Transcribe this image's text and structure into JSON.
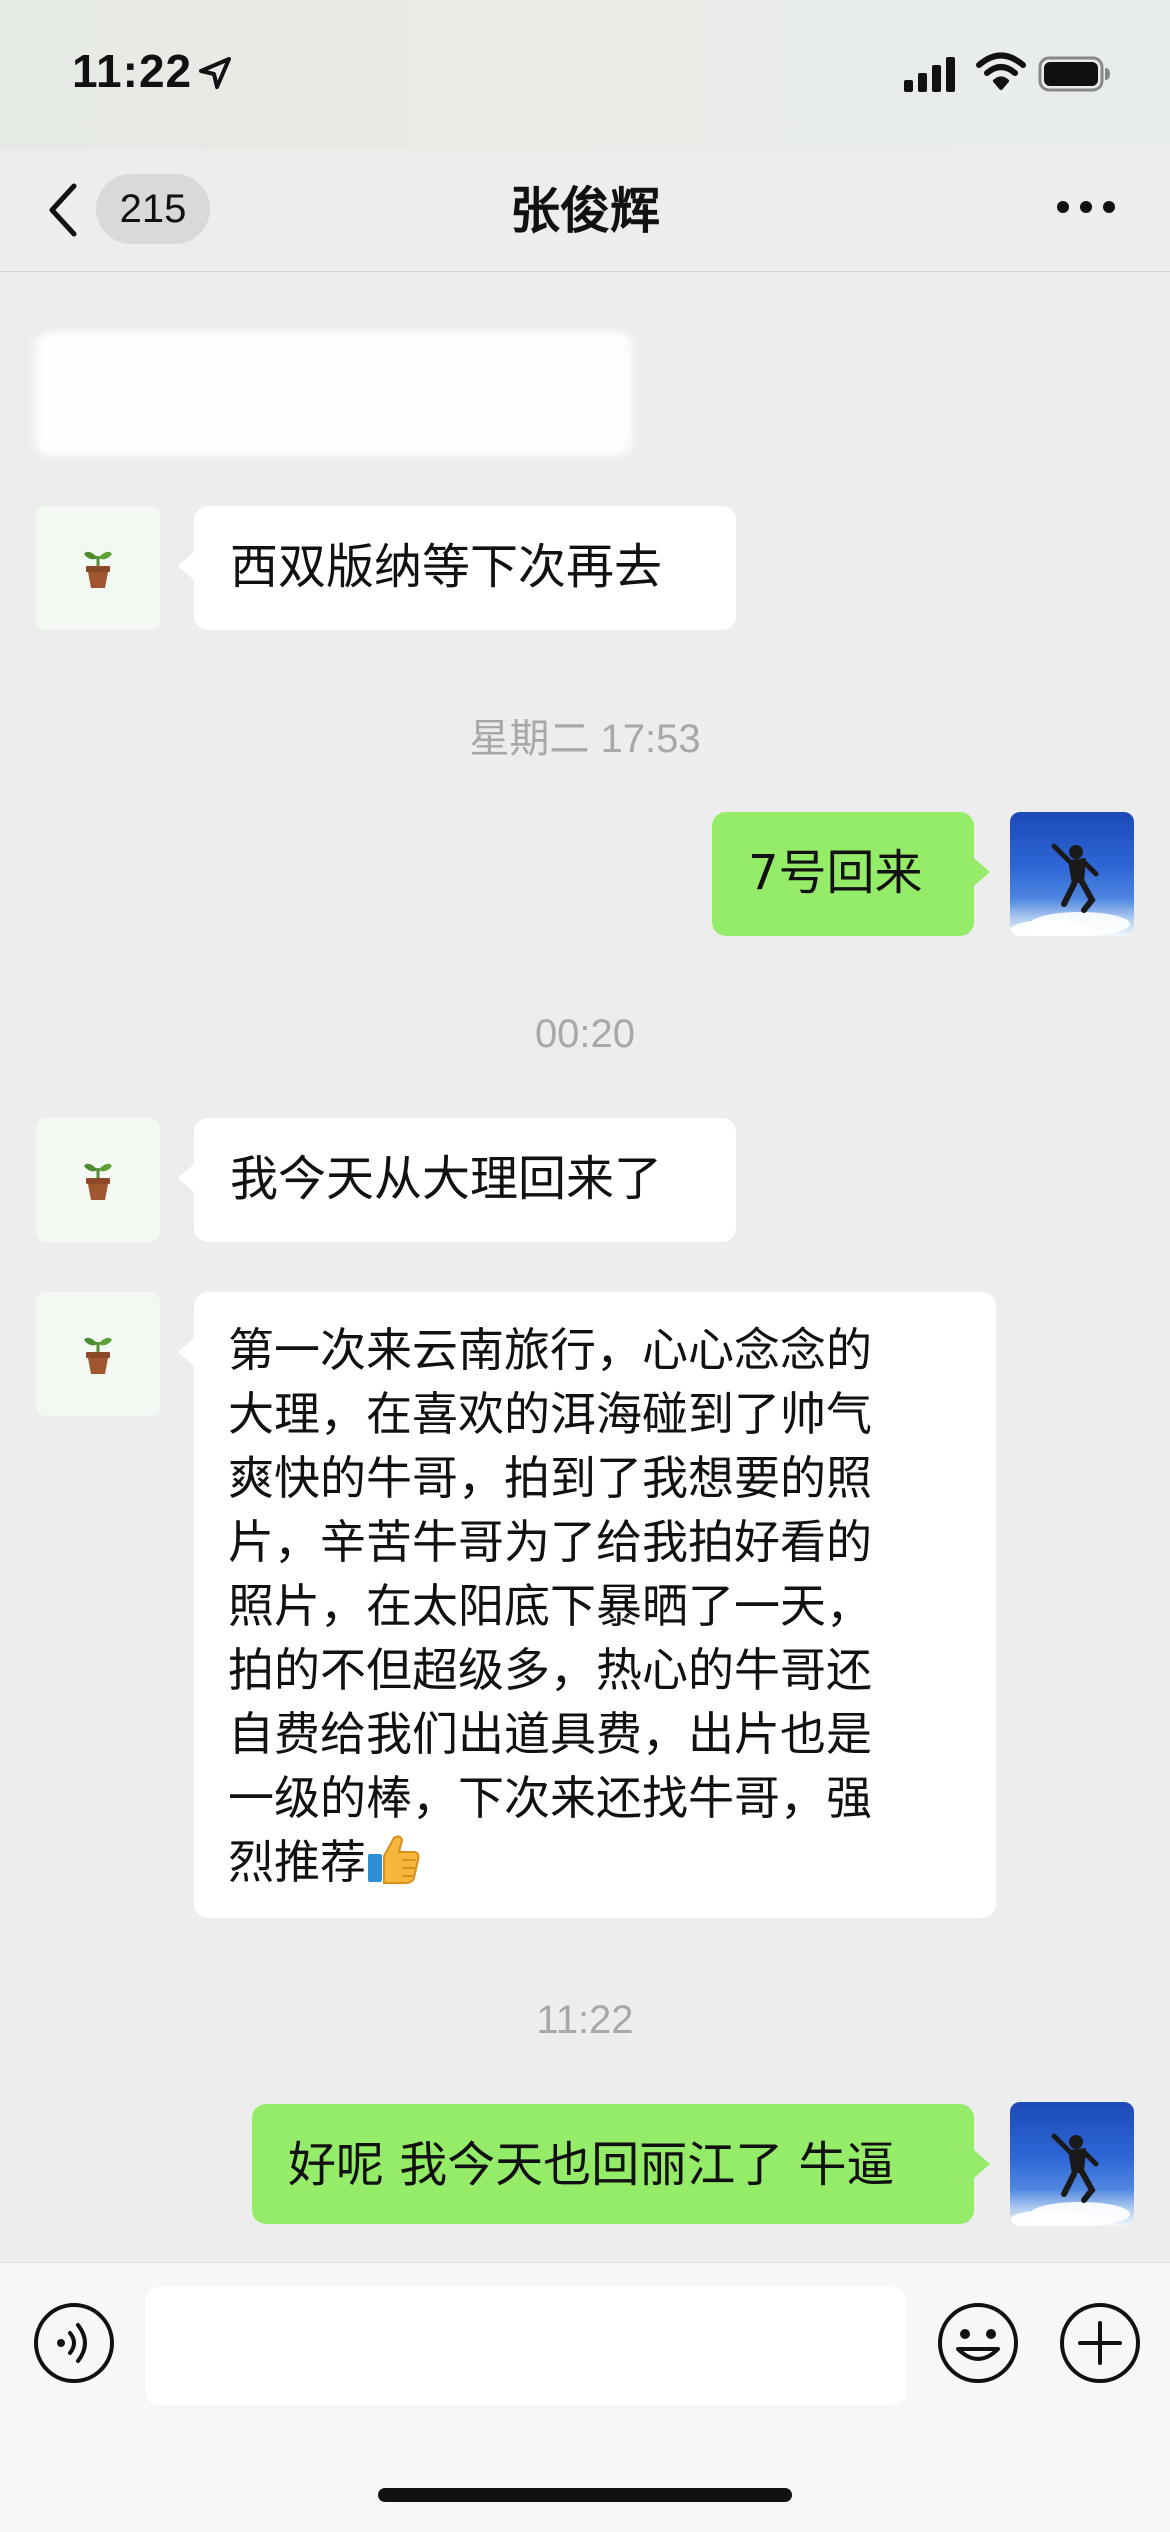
{
  "status_bar": {
    "time": "11:22"
  },
  "header": {
    "unread_count": "215",
    "title": "张俊辉"
  },
  "messages": [
    {
      "sender": "other",
      "text": "西双版纳等下次再去"
    },
    {
      "type": "timestamp",
      "text": "星期二 17:53"
    },
    {
      "sender": "me",
      "text": "7号回来"
    },
    {
      "type": "timestamp",
      "text": "00:20"
    },
    {
      "sender": "other",
      "text": "我今天从大理回来了"
    },
    {
      "sender": "other",
      "text": "第一次来云南旅行，心心念念的\n大理，在喜欢的洱海碰到了帅气\n爽快的牛哥，拍到了我想要的照\n片，辛苦牛哥为了给我拍好看的\n照片，在太阳底下暴晒了一天，\n拍的不但超级多，热心的牛哥还\n自费给我们出道具费，出片也是\n一级的棒，下次来还找牛哥，强\n烈推荐",
      "emoji": "thumbs-up"
    },
    {
      "type": "timestamp",
      "text": "11:22"
    },
    {
      "sender": "me",
      "text": "好呢 我今天也回丽江了 牛逼"
    }
  ],
  "input": {
    "value": "",
    "placeholder": ""
  },
  "colors": {
    "background": "#ededed",
    "bubble_me": "#95ec69",
    "bubble_other": "#ffffff",
    "timestamp": "#a8a8a8"
  },
  "icons": {
    "back": "chevron-left-icon",
    "more": "more-dots-icon",
    "voice": "voice-icon",
    "emoji": "emoji-icon",
    "plus": "plus-icon"
  }
}
